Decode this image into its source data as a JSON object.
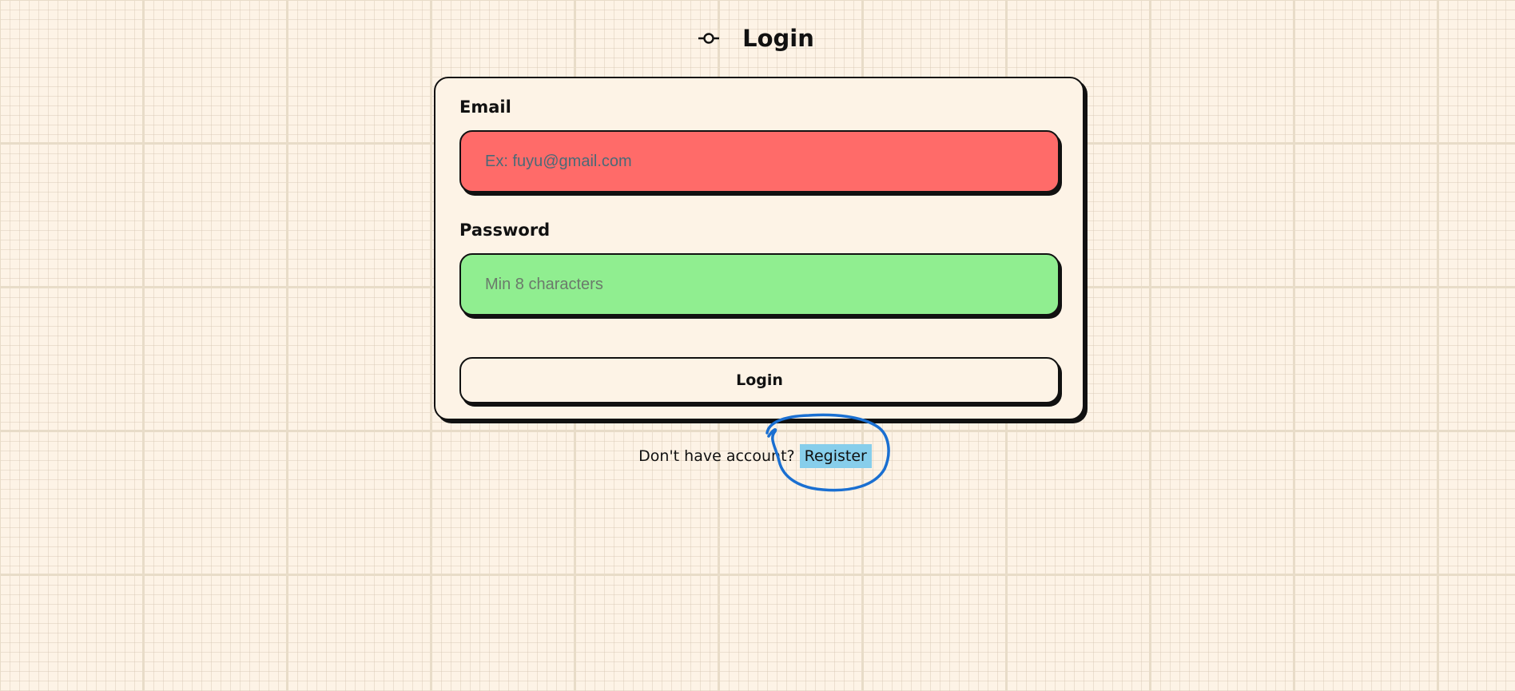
{
  "header": {
    "icon": "commit-icon",
    "title": "Login"
  },
  "form": {
    "email": {
      "label": "Email",
      "placeholder": "Ex: fuyu@gmail.com",
      "value": ""
    },
    "password": {
      "label": "Password",
      "placeholder": "Min 8 characters",
      "value": ""
    },
    "submit_label": "Login"
  },
  "footer": {
    "prompt_text": "Don't have account?",
    "register_label": "Register"
  },
  "colors": {
    "background": "#fdf3e6",
    "email_field": "#ff6b69",
    "password_field": "#90ee90",
    "register_highlight": "#87ceeb",
    "annotation_stroke": "#1a6fd1"
  }
}
